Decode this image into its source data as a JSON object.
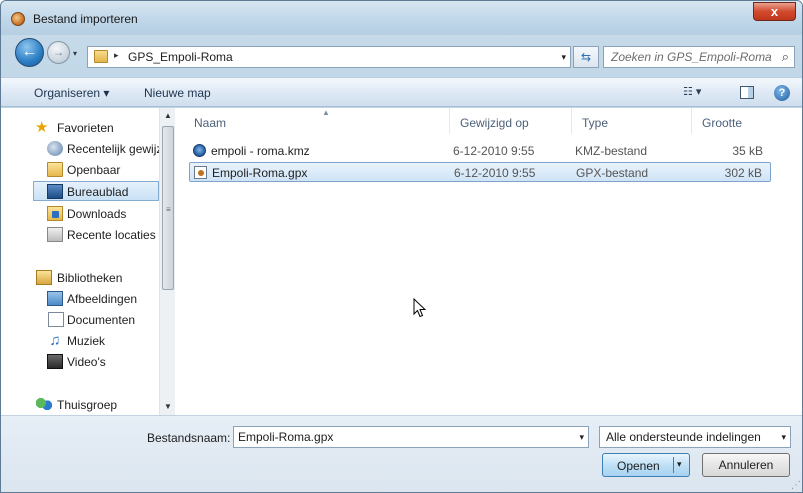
{
  "window": {
    "title": "Bestand importeren",
    "close": "x"
  },
  "navigation": {
    "back": "←",
    "forward": "→",
    "history_dropdown": "▾",
    "breadcrumb_sep": "▸",
    "path": "GPS_Empoli-Roma",
    "address_dropdown": "▾",
    "refresh": "⇆",
    "search_placeholder": "Zoeken in GPS_Empoli-Roma",
    "search_icon": "⌕"
  },
  "toolbar": {
    "organise_label": "Organiseren ▾",
    "new_folder_label": "Nieuwe map",
    "view_icon": "☷ ▾",
    "help_icon": "?"
  },
  "sidebar": {
    "items": [
      {
        "label": "Favorieten",
        "icon": "star-icon"
      },
      {
        "label": "Recentelijk gewijzigd",
        "icon": "recent-icon"
      },
      {
        "label": "Openbaar",
        "icon": "folder-icon"
      },
      {
        "label": "Bureaublad",
        "icon": "desktop-icon",
        "selected": true
      },
      {
        "label": "Downloads",
        "icon": "download-folder-icon"
      },
      {
        "label": "Recente locaties",
        "icon": "recent-places-icon"
      },
      {
        "label": "Bibliotheken",
        "icon": "library-icon"
      },
      {
        "label": "Afbeeldingen",
        "icon": "pictures-icon"
      },
      {
        "label": "Documenten",
        "icon": "documents-icon"
      },
      {
        "label": "Muziek",
        "icon": "music-icon"
      },
      {
        "label": "Video's",
        "icon": "video-icon"
      },
      {
        "label": "Thuisgroep",
        "icon": "homegroup-icon"
      }
    ],
    "scroll_up": "▲",
    "scroll_down": "▼",
    "grip": "≡"
  },
  "file_list": {
    "sort_indicator": "▲",
    "columns": [
      "Naam",
      "Gewijzigd op",
      "Type",
      "Grootte"
    ],
    "rows": [
      {
        "name": "empoli - roma.kmz",
        "date": "6-12-2010 9:55",
        "type": "KMZ-bestand",
        "size": "35 kB",
        "icon": "kmz-file-icon",
        "selected": false
      },
      {
        "name": "Empoli-Roma.gpx",
        "date": "6-12-2010 9:55",
        "type": "GPX-bestand",
        "size": "302 kB",
        "icon": "gpx-file-icon",
        "selected": true
      }
    ]
  },
  "footer": {
    "filename_label": "Bestandsnaam:",
    "filename_value": "Empoli-Roma.gpx",
    "filename_dropdown": "▾",
    "filter_value": "Alle ondersteunde indelingen (*",
    "filter_dropdown": "▾",
    "open_label": "Openen",
    "open_dropdown": "▾",
    "cancel_label": "Annuleren",
    "resize_grip": "⋰"
  }
}
